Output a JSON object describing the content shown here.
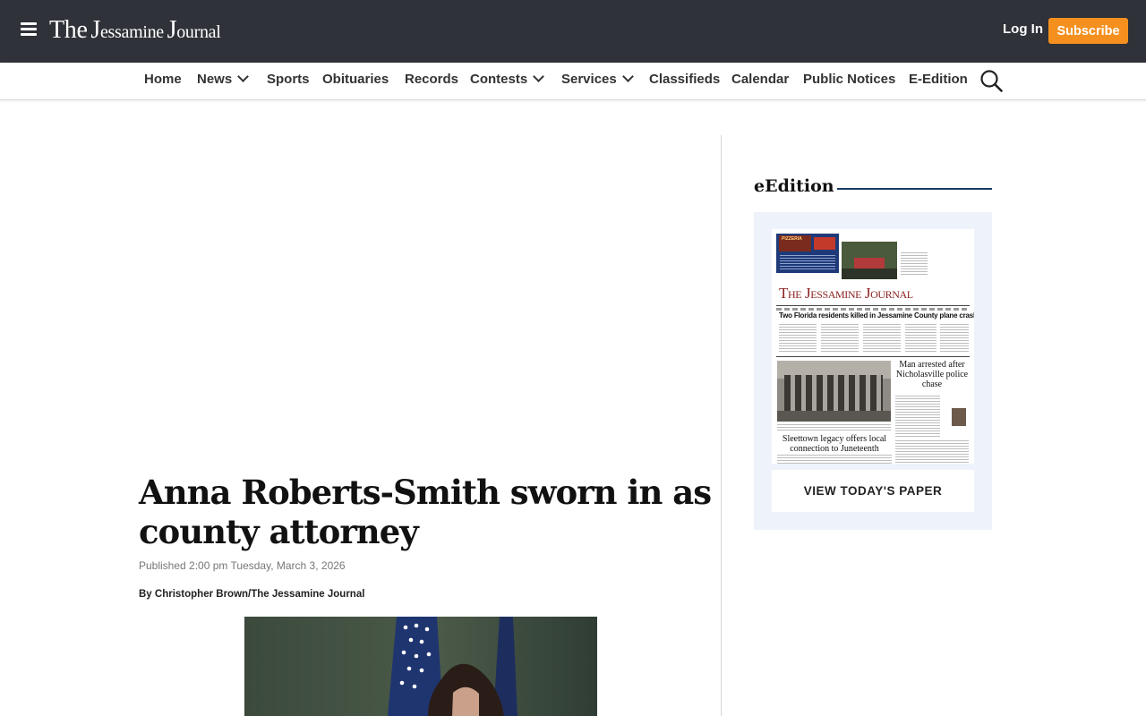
{
  "header": {
    "logo_the": "The",
    "logo_j": "J",
    "logo_essamine": "essamine",
    "logo_j2": "J",
    "logo_ournal": "ournal",
    "login_label": "Log In",
    "subscribe_label": "Subscribe"
  },
  "nav": {
    "items": [
      {
        "label": "Home",
        "dropdown": false
      },
      {
        "label": "News",
        "dropdown": true
      },
      {
        "label": "Sports",
        "dropdown": false
      },
      {
        "label": "Obituaries",
        "dropdown": false
      },
      {
        "label": "Records",
        "dropdown": false
      },
      {
        "label": "Contests",
        "dropdown": true
      },
      {
        "label": "Services",
        "dropdown": true
      },
      {
        "label": "Classifieds",
        "dropdown": false
      },
      {
        "label": "Calendar",
        "dropdown": false
      },
      {
        "label": "Public Notices",
        "dropdown": false
      },
      {
        "label": "E-Edition",
        "dropdown": false
      }
    ]
  },
  "article": {
    "headline": "Anna Roberts-Smith sworn in as county attorney",
    "published": "Published 2:00 pm Tuesday, March 3, 2026",
    "byline": "By Christopher Brown/The Jessamine Journal"
  },
  "sidebar": {
    "edition_title": "eEdition",
    "view_paper_label": "VIEW TODAY'S PAPER",
    "paper": {
      "ad_label": "PIZZERIA",
      "masthead": "The Jessamine Journal",
      "headline_1": "Two Florida residents killed in Jessamine County plane crash",
      "headline_2": "Man arrested after Nicholasville police chase",
      "headline_3": "Sleettown legacy offers local connection to Juneteenth"
    }
  },
  "colors": {
    "header_bg": "#2f3238",
    "subscribe_bg": "#f5901e",
    "edition_rule": "#1b3a63",
    "edition_box_bg": "#eef3fb"
  }
}
